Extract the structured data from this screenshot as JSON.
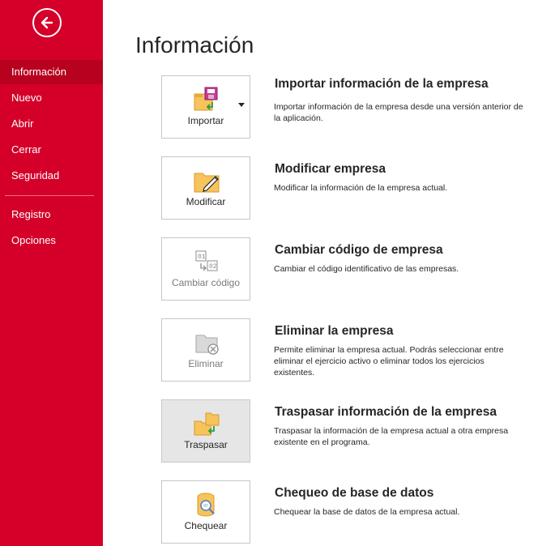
{
  "sidebar": {
    "back_icon": "arrow-left-icon",
    "items": [
      {
        "label": "Información",
        "active": true
      },
      {
        "label": "Nuevo"
      },
      {
        "label": "Abrir"
      },
      {
        "label": "Cerrar"
      },
      {
        "label": "Seguridad"
      },
      {
        "label": "Registro"
      },
      {
        "label": "Opciones"
      }
    ],
    "accent_color": "#d4002a",
    "active_color": "#b8001f"
  },
  "main": {
    "title": "Información",
    "sections": [
      {
        "button_label": "Importar",
        "icon": "import-icon",
        "title": "Importar información de la empresa",
        "description": "Importar información de la empresa desde una versión anterior de la aplicación."
      },
      {
        "button_label": "Modificar",
        "icon": "edit-folder-icon",
        "title": "Modificar empresa",
        "description": "Modificar la información de la empresa actual."
      },
      {
        "button_label": "Cambiar código",
        "icon": "change-code-icon",
        "title": "Cambiar código de empresa",
        "description": "Cambiar el código identificativo de las empresas."
      },
      {
        "button_label": "Eliminar",
        "icon": "delete-folder-icon",
        "title": "Eliminar la empresa",
        "description": "Permite eliminar la empresa actual. Podrás seleccionar entre eliminar el ejercicio activo o eliminar todos los ejercicios existentes."
      },
      {
        "button_label": "Traspasar",
        "icon": "transfer-icon",
        "title": "Traspasar información de la empresa",
        "description": "Traspasar la información de la empresa actual a otra empresa existente en el programa."
      },
      {
        "button_label": "Chequear",
        "icon": "database-check-icon",
        "title": "Chequeo de base de datos",
        "description": "Chequear la base de datos de la empresa actual."
      }
    ]
  }
}
